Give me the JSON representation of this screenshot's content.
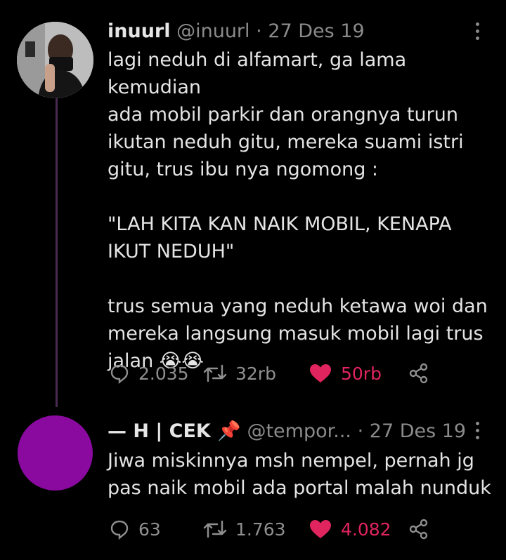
{
  "tweet": {
    "name": "inuurl",
    "handle": "@inuurl",
    "separator": "·",
    "date": "27 Des 19",
    "text": "lagi neduh di alfamart, ga lama kemudian\nada mobil parkir dan orangnya turun\nikutan neduh gitu, mereka suami istri\ngitu, trus ibu nya ngomong :\n\n\"LAH KITA KAN NAIK MOBIL, KENAPA\nIKUT NEDUH\"\n\ntrus semua yang neduh ketawa woi dan\nmereka langsung masuk mobil lagi trus\njalan 😭😭",
    "replies": "2.035",
    "retweets": "32rb",
    "likes": "50rb"
  },
  "reply": {
    "name": "— H | CEK 📌",
    "handle": "@tempor...",
    "separator": "·",
    "date": "27 Des 19",
    "text": "Jiwa miskinnya msh nempel, pernah jg\npas naik mobil ada portal malah nunduk",
    "replies": "63",
    "retweets": "1.763",
    "likes": "4.082"
  },
  "colors": {
    "background": "#000000",
    "like_active": "#e0245e",
    "avatar_reply": "#8a0aa0",
    "thread_line": "#4a2a52"
  }
}
